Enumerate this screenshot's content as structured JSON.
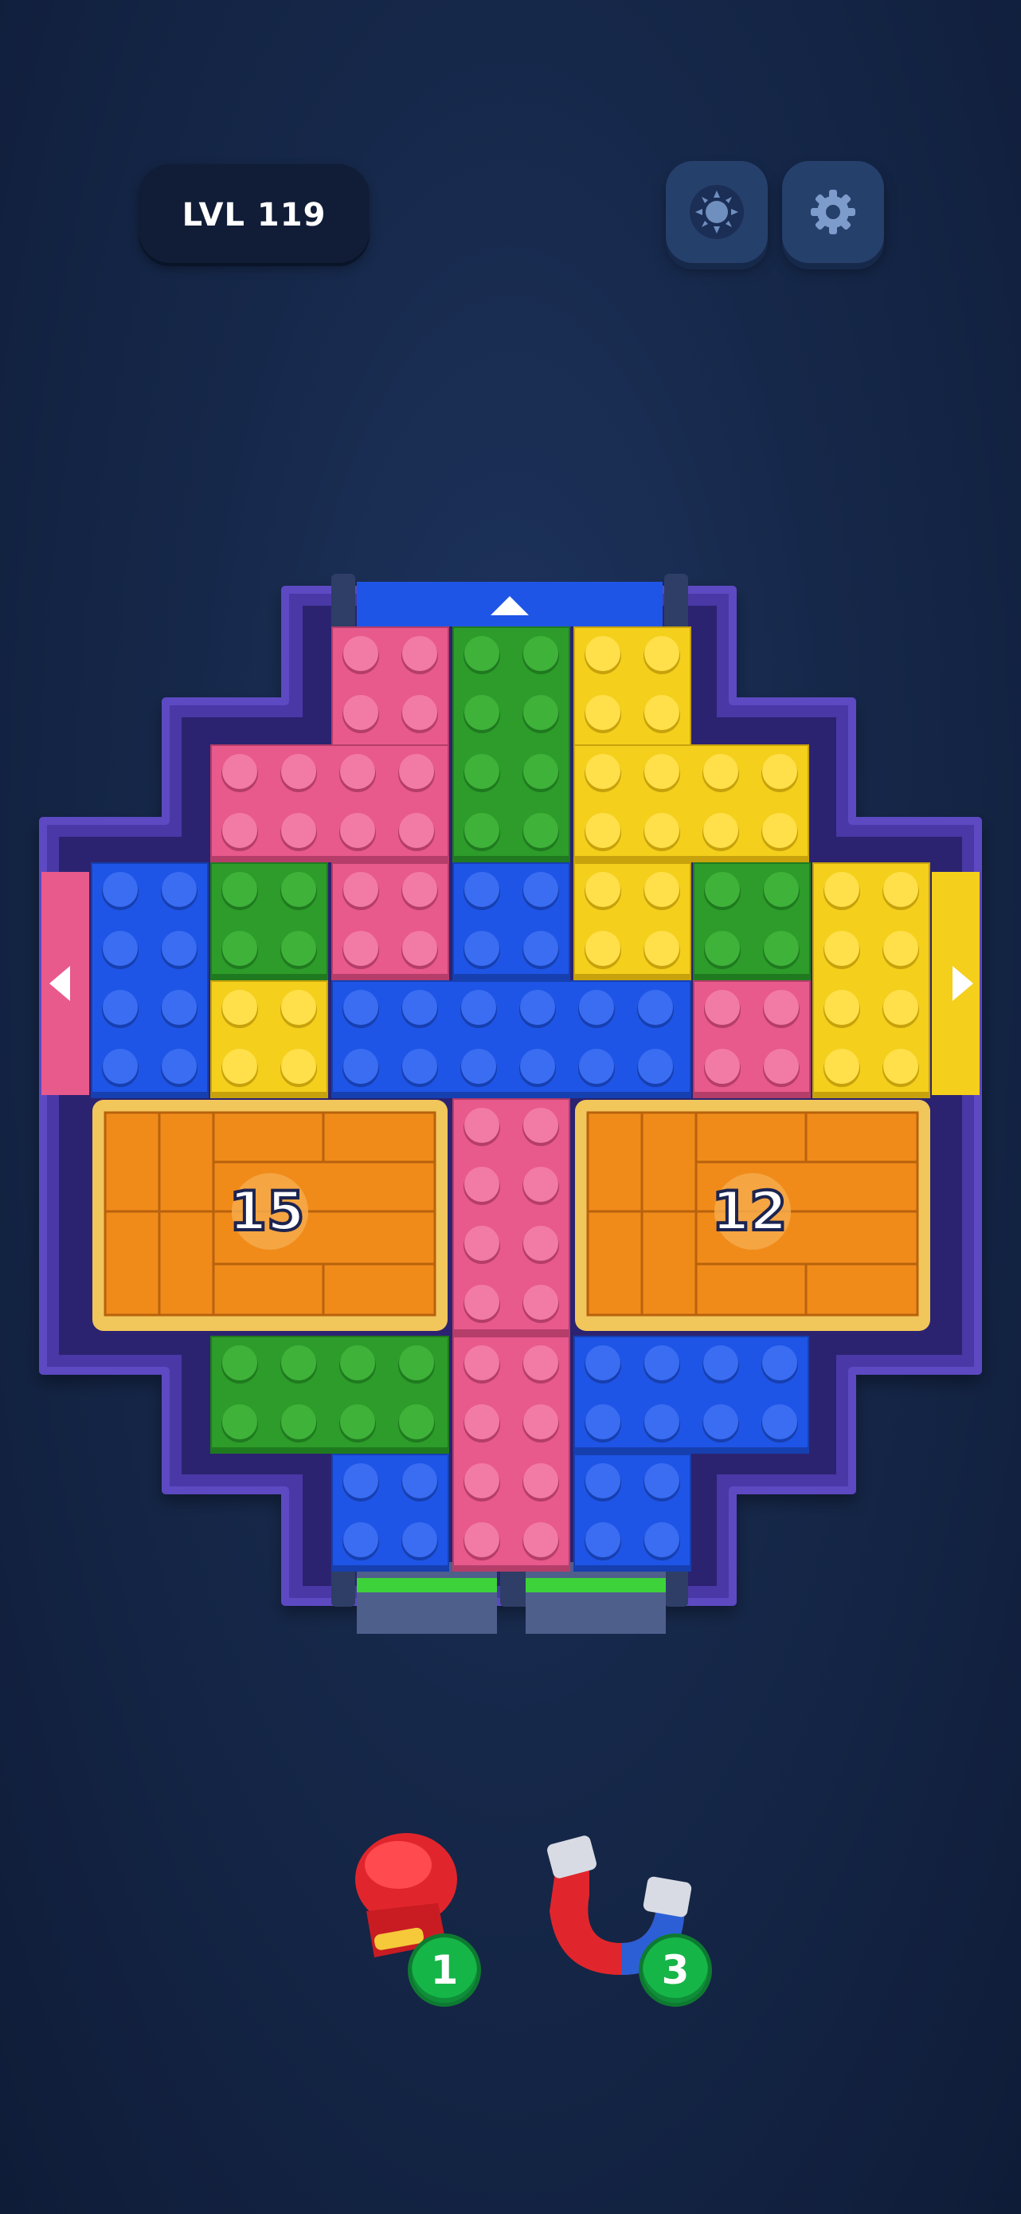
{
  "hud": {
    "level_label": "LVL 119",
    "buttons": [
      {
        "name": "theme-toggle-button",
        "icon": "sun-icon"
      },
      {
        "name": "settings-button",
        "icon": "gear-icon"
      }
    ]
  },
  "colors": {
    "pink": "#e8598c",
    "green": "#2d9c2a",
    "yellow": "#f4cf1c",
    "blue": "#1f55e6",
    "orange": "#f08b1a",
    "frame": "#4a37a6"
  },
  "board": {
    "exits": [
      {
        "side": "top",
        "color": "blue"
      },
      {
        "side": "left",
        "color": "pink"
      },
      {
        "side": "right",
        "color": "yellow"
      },
      {
        "side": "bottom-left",
        "color": "green"
      },
      {
        "side": "bottom-right",
        "color": "green"
      }
    ],
    "crates": [
      {
        "name": "crate-left",
        "count": "15"
      },
      {
        "name": "crate-right",
        "count": "12"
      }
    ]
  },
  "boosters": [
    {
      "name": "boxing-glove-booster",
      "icon": "boxing-glove-icon",
      "count": "1"
    },
    {
      "name": "magnet-booster",
      "icon": "magnet-icon",
      "count": "3"
    }
  ]
}
